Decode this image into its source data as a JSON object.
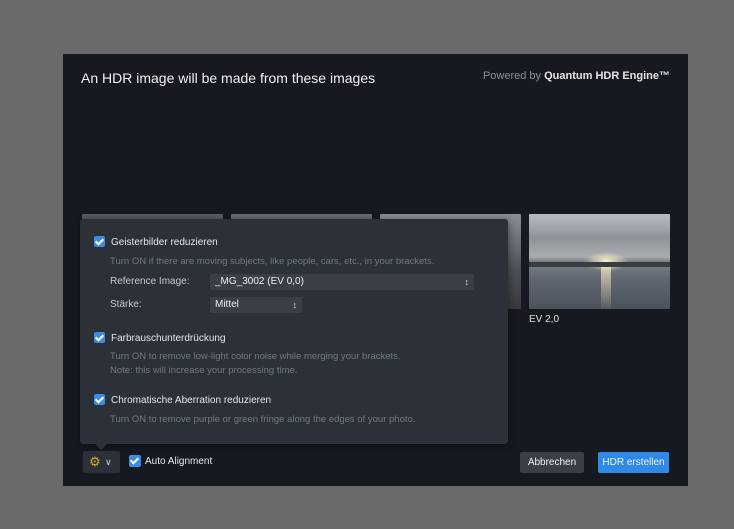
{
  "dialog": {
    "title": "An HDR image will be made from these images",
    "powered_prefix": "Powered by",
    "powered_brand": "Quantum HDR Engine™"
  },
  "thumbnails": [
    {
      "name": "image-1"
    },
    {
      "name": "image-2"
    },
    {
      "name": "image-3"
    },
    {
      "name": "image-4",
      "label": "EV 2,0"
    }
  ],
  "settings": {
    "ghost": {
      "checked": true,
      "label": "Geisterbilder reduzieren",
      "hint": "Turn ON if there are moving subjects, like people, cars, etc., in your brackets.",
      "reference_label": "Reference Image:",
      "reference_value": "_MG_3002 (EV 0,0)",
      "strength_label": "Stärke:",
      "strength_value": "Mittel"
    },
    "noise": {
      "checked": true,
      "label": "Farbrauschunterdrückung",
      "hint1": "Turn ON to remove low-light color noise while merging your brackets.",
      "hint2": "Note: this will increase your processing time."
    },
    "chromatic": {
      "checked": true,
      "label": "Chromatische Aberration reduzieren",
      "hint": "Turn ON to remove purple or green fringe along the edges of your photo."
    }
  },
  "footer": {
    "auto_alignment_checked": true,
    "auto_alignment_label": "Auto Alignment",
    "cancel_label": "Abbrechen",
    "create_label": "HDR erstellen"
  },
  "colors": {
    "accent": "#2e8ae6",
    "gear": "#e0a42a"
  },
  "icons": {
    "settings": "gear-icon",
    "dropdown": "chevron-down-icon",
    "select": "up-down-chevron-icon"
  }
}
